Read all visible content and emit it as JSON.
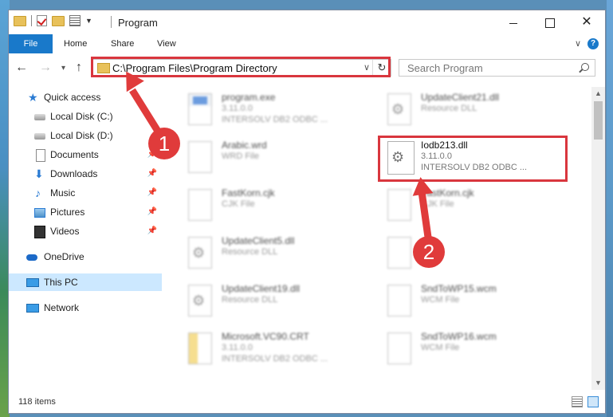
{
  "window": {
    "title": "Program"
  },
  "ribbon": {
    "tabs": [
      "File",
      "Home",
      "Share",
      "View"
    ]
  },
  "address": {
    "path": "C:\\Program Files\\Program Directory"
  },
  "search": {
    "placeholder": "Search Program"
  },
  "sidebar": {
    "items": [
      {
        "label": "Quick access",
        "icon": "star-icon"
      },
      {
        "label": "Local Disk (C:)",
        "icon": "drive-icon"
      },
      {
        "label": "Local Disk (D:)",
        "icon": "drive-icon"
      },
      {
        "label": "Documents",
        "icon": "documents-icon"
      },
      {
        "label": "Downloads",
        "icon": "download-icon"
      },
      {
        "label": "Music",
        "icon": "music-icon"
      },
      {
        "label": "Pictures",
        "icon": "pictures-icon"
      },
      {
        "label": "Videos",
        "icon": "videos-icon"
      },
      {
        "label": "OneDrive",
        "icon": "cloud-icon"
      },
      {
        "label": "This PC",
        "icon": "computer-icon"
      },
      {
        "label": "Network",
        "icon": "network-icon"
      }
    ]
  },
  "files": [
    {
      "name": "program.exe",
      "line1": "3.11.0.0",
      "line2": "INTERSOLV DB2 ODBC ..."
    },
    {
      "name": "UpdateClient21.dll",
      "line1": "Resource DLL",
      "line2": ""
    },
    {
      "name": "Arabic.wrd",
      "line1": "WRD File",
      "line2": ""
    },
    {
      "name": "Iodb213.dll",
      "line1": "3.11.0.0",
      "line2": "INTERSOLV DB2 ODBC ..."
    },
    {
      "name": "FastKorn.cjk",
      "line1": "CJK File",
      "line2": ""
    },
    {
      "name": "FastKorn.cjk",
      "line1": "CJK File",
      "line2": ""
    },
    {
      "name": "UpdateClient5.dll",
      "line1": "Resource DLL",
      "line2": ""
    },
    {
      "name": "",
      "line1": "",
      "line2": ""
    },
    {
      "name": "UpdateClient19.dll",
      "line1": "Resource DLL",
      "line2": ""
    },
    {
      "name": "SndToWP15.wcm",
      "line1": "WCM File",
      "line2": ""
    },
    {
      "name": "Microsoft.VC90.CRT",
      "line1": "3.11.0.0",
      "line2": "INTERSOLV DB2 ODBC ..."
    },
    {
      "name": "SndToWP16.wcm",
      "line1": "WCM File",
      "line2": ""
    }
  ],
  "status": {
    "item_count": "118 items"
  },
  "annotations": {
    "badge1": "1",
    "badge2": "2"
  },
  "colors": {
    "accent": "#1979ca",
    "highlight": "#d9363e",
    "selection": "#cce8ff"
  }
}
